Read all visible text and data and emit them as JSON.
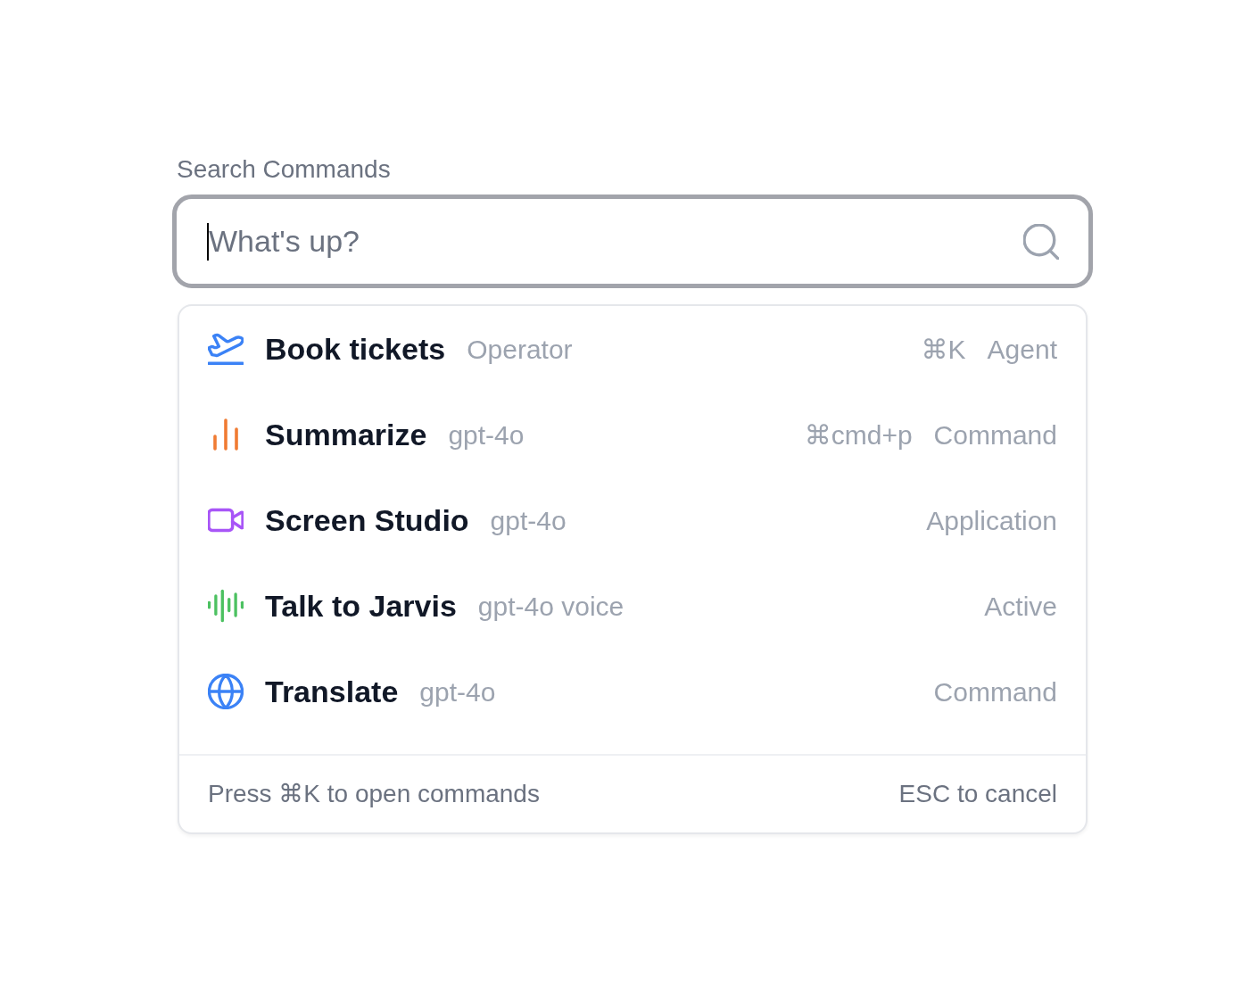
{
  "search": {
    "label": "Search Commands",
    "placeholder": "What's up?",
    "focused": true
  },
  "commands": [
    {
      "kind": "plane",
      "title": "Book tickets",
      "model": "Operator",
      "shortcut": "⌘K",
      "type": "Agent"
    },
    {
      "kind": "chart",
      "title": "Summarize",
      "model": "gpt-4o",
      "shortcut": "⌘cmd+p",
      "type": "Command"
    },
    {
      "kind": "video",
      "title": "Screen Studio",
      "model": "gpt-4o",
      "type": "Application"
    },
    {
      "kind": "audio",
      "title": "Talk to Jarvis",
      "model": "gpt-4o voice",
      "type": "Active"
    },
    {
      "kind": "globe",
      "title": "Translate",
      "model": "gpt-4o",
      "type": "Command"
    }
  ],
  "footer": {
    "hint": "Press ⌘K to open commands",
    "cancel": "ESC to cancel"
  }
}
